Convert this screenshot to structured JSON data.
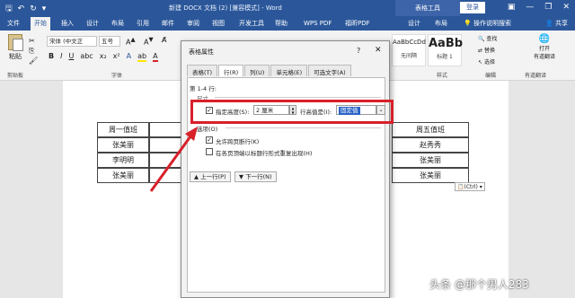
{
  "title_bar": {
    "doc_title": "新建 DOCX 文档 (2) [兼容模式] - Word",
    "table_tools": "表格工具",
    "login": "登录"
  },
  "tabs": [
    "文件",
    "开始",
    "插入",
    "设计",
    "布局",
    "引用",
    "邮件",
    "审阅",
    "视图",
    "开发工具",
    "帮助",
    "WPS PDF",
    "福昕PDF",
    "设计",
    "布局"
  ],
  "active_tab": "开始",
  "help_search": "操作说明搜索",
  "share": "共享",
  "ribbon": {
    "paste": "粘贴",
    "clipboard_label": "剪贴板",
    "font_name": "宋体 (中文正",
    "font_size": "五号",
    "font_label": "字体",
    "styles": [
      {
        "sample": "AaBbCcDd",
        "name": "无间隔"
      },
      {
        "sample": "AaBb",
        "name": "标题 1"
      }
    ],
    "styles_label": "样式",
    "find": "查找",
    "replace": "替换",
    "select": "选择",
    "edit_label": "编辑",
    "open_label": "打开",
    "translate": "有道翻译",
    "translate_group": "有道翻译"
  },
  "table_left": [
    [
      "周一值班"
    ],
    [
      "张美丽"
    ],
    [
      "李明明"
    ],
    [
      "张美丽"
    ]
  ],
  "table_right": [
    [
      "周五值班"
    ],
    [
      "赵秀秀"
    ],
    [
      "张美丽"
    ],
    [
      "张美丽"
    ]
  ],
  "ctrl_tag": "(Ctrl)",
  "dialog": {
    "title": "表格属性",
    "help": "?",
    "close": "✕",
    "tabs": [
      "表格(T)",
      "行(R)",
      "列(U)",
      "单元格(E)",
      "可选文字(A)"
    ],
    "active_tab": "行(R)",
    "row_label": "第 1-4 行:",
    "size_label": "尺寸",
    "specify_height": "指定高度(S):",
    "height_value": "2 厘米",
    "row_height_is": "行高值是(I):",
    "row_height_mode": "固定值",
    "options_label": "选项(O)",
    "allow_break": "允许跨页断行(K)",
    "repeat_header": "在各页顶端以标题行形式重复出现(H)",
    "prev_row": "▲ 上一行(P)",
    "next_row": "▼ 下一行(N)"
  },
  "watermark": "头条 @那个男人283",
  "colors": {
    "word_blue": "#2b579a",
    "highlight_red": "#d8202a",
    "selection_blue": "#2a64c6"
  }
}
